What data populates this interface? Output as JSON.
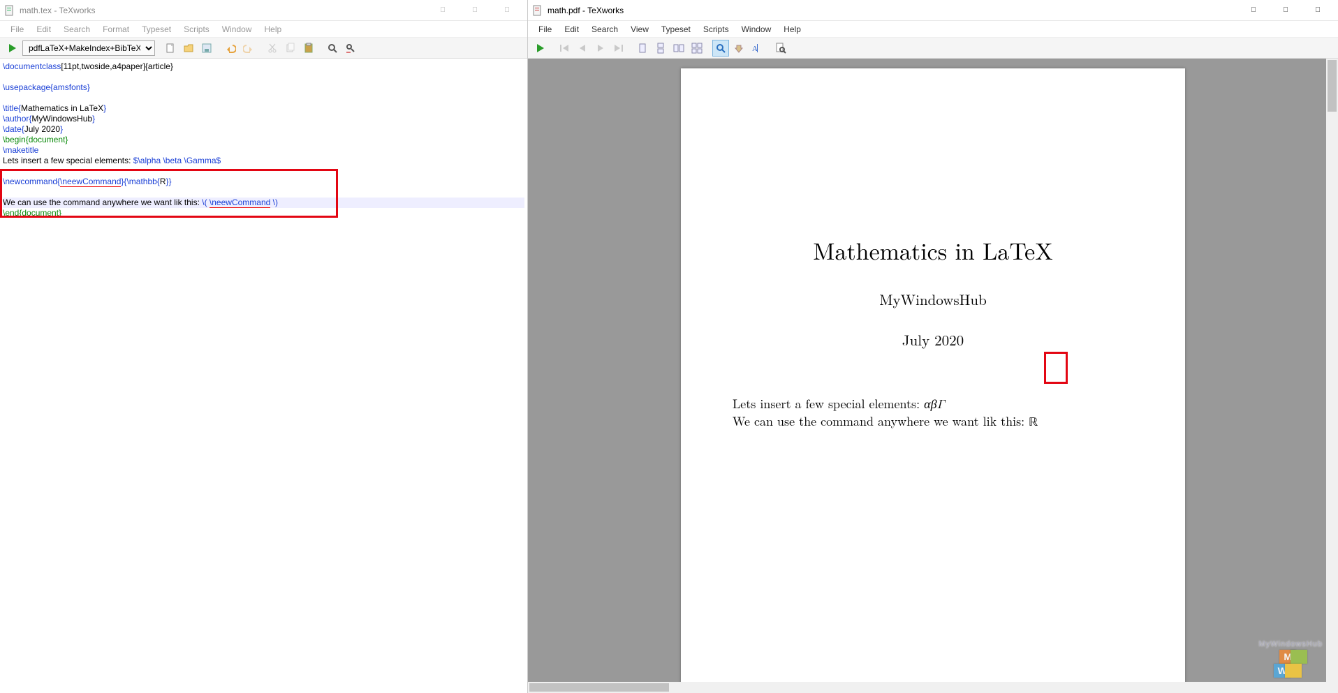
{
  "left": {
    "title": "math.tex - TeXworks",
    "active": false,
    "menu": [
      "File",
      "Edit",
      "Search",
      "Format",
      "Typeset",
      "Scripts",
      "Window",
      "Help"
    ],
    "typeset_select": "pdfLaTeX+MakeIndex+BibTeX",
    "source": {
      "l1_cmd": "\\documentclass",
      "l1_arg": "[11pt,twoside,a4paper]{article}",
      "l3_cmd": "\\usepackage{amsfonts}",
      "l5_cmd": "\\title{",
      "l5_arg": "Mathematics in LaTeX",
      "l5_end": "}",
      "l6_cmd": "\\author{",
      "l6_arg": "MyWindowsHub",
      "l6_end": "}",
      "l7_cmd": "\\date{",
      "l7_arg": "July 2020",
      "l7_end": "}",
      "l8_env": "\\begin{document}",
      "l9_cmd": "\\maketitle",
      "l10_txt": "Lets insert a few special elements: ",
      "l10_math": "$\\alpha \\beta \\Gamma$",
      "l12_cmd": "\\newcommand{",
      "l12_u": "\\neewCommand",
      "l12_mid": "}{",
      "l12_b": "\\mathbb{",
      "l12_barg": "R",
      "l12_end": "}}",
      "l14_txt": "We can use the command anywhere we want lik this: ",
      "l14_open": "\\( ",
      "l14_u": "\\neewCommand",
      "l14_close": " \\)",
      "l15_env": "\\end{document}"
    }
  },
  "right": {
    "title": "math.pdf - TeXworks",
    "active": true,
    "menu": [
      "File",
      "Edit",
      "Search",
      "View",
      "Typeset",
      "Scripts",
      "Window",
      "Help"
    ],
    "pdf": {
      "title": "Mathematics in LaTeX",
      "author": "MyWindowsHub",
      "date": "July 2020",
      "body1_pre": "Lets insert a few special elements: ",
      "body1_sym": "αβΓ",
      "body2_pre": "We can use the command anywhere we want lik this: ",
      "body2_sym": "ℝ"
    }
  },
  "watermark": "MyWindowsHub"
}
